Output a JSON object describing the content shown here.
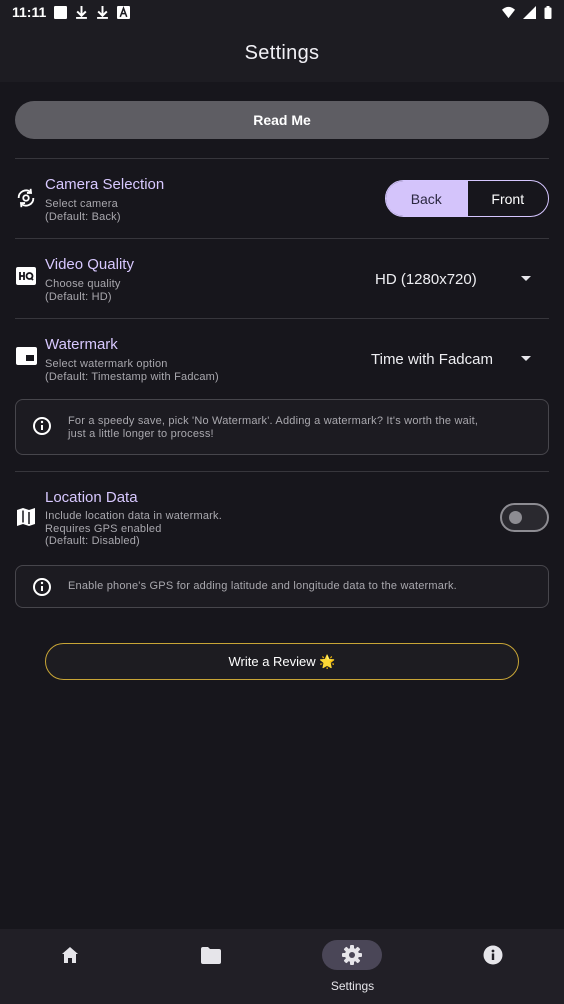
{
  "status_bar": {
    "time": "11:11"
  },
  "app_bar": {
    "title": "Settings"
  },
  "readme": {
    "label": "Read Me"
  },
  "camera": {
    "title": "Camera Selection",
    "subtitle_1": "Select camera",
    "subtitle_2": "(Default: Back)",
    "options": [
      "Back",
      "Front"
    ],
    "selected": "Back"
  },
  "video": {
    "title": "Video Quality",
    "subtitle_1": "Choose quality",
    "subtitle_2": "(Default: HD)",
    "value": "HD (1280x720)"
  },
  "watermark": {
    "title": "Watermark",
    "subtitle_1": "Select watermark option",
    "subtitle_2": "(Default: Timestamp with Fadcam)",
    "value": "Time with Fadcam",
    "info_1": "For a speedy save, pick 'No Watermark'. Adding a watermark? It's worth the wait,",
    "info_2": "just a little longer to process!"
  },
  "location": {
    "title": "Location Data",
    "subtitle_1": "Include location data in watermark.",
    "subtitle_2": "Requires GPS enabled",
    "subtitle_3": "(Default: Disabled)",
    "enabled": false,
    "info": "Enable phone's GPS for adding latitude and longitude data to the watermark."
  },
  "review": {
    "label": "Write a Review 🌟"
  },
  "bottom_nav": {
    "items": [
      {
        "icon": "home-icon",
        "label": ""
      },
      {
        "icon": "folder-icon",
        "label": ""
      },
      {
        "icon": "gear-icon",
        "label": "Settings"
      },
      {
        "icon": "info-icon",
        "label": ""
      }
    ],
    "active_index": 2
  },
  "colors": {
    "background": "#17161c",
    "accent": "#d8c8ff",
    "review_border": "#c8a536"
  }
}
